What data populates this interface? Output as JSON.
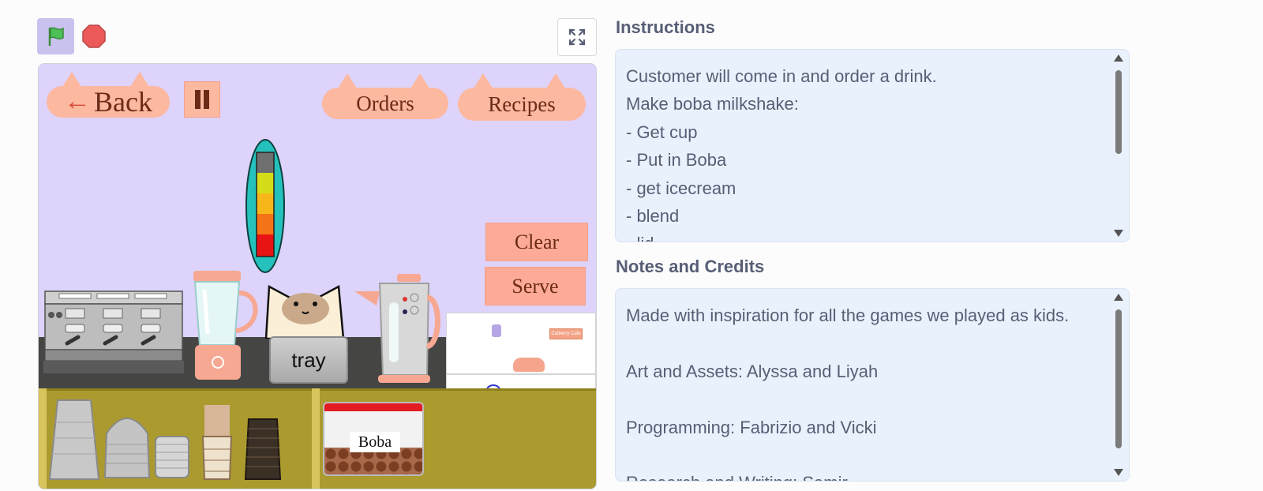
{
  "controls": {
    "flag_icon": "green-flag-icon",
    "stop_icon": "stop-sign-icon",
    "fullscreen_icon": "fullscreen-icon"
  },
  "stage": {
    "back_label": "Back",
    "orders_label": "Orders",
    "recipes_label": "Recipes",
    "clear_label": "Clear",
    "serve_label": "Serve",
    "tray_label": "tray",
    "boba_label": "Boba",
    "mini_sign": "Catberry Cafe",
    "colors": {
      "background": "#ddd3fb",
      "button": "#fdb8a0",
      "counter": "#454644",
      "shelf": "#ab9a2e"
    }
  },
  "instructions": {
    "heading": "Instructions",
    "text": "Customer will come in and order a drink.\nMake boba milkshake:\n- Get cup\n- Put in Boba\n- get icecream\n- blend\n- lid"
  },
  "notes": {
    "heading": "Notes and Credits",
    "text": "Made with inspiration for all the games we played as kids.\n\nArt and Assets: Alyssa and Liyah\n\nProgramming: Fabrizio and Vicki\n\nResearch and Writing: Samir"
  }
}
